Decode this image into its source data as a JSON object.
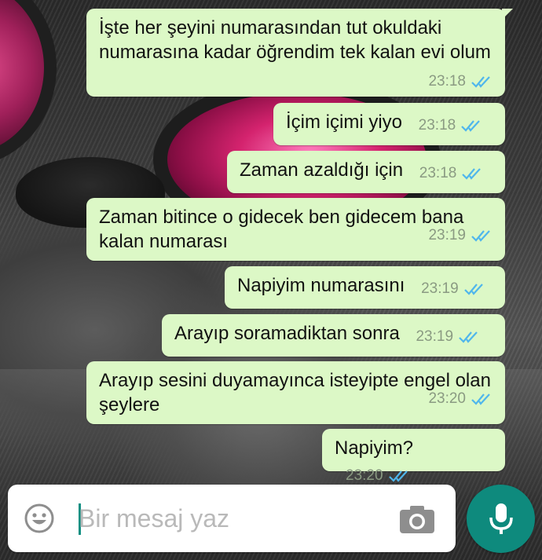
{
  "messages": [
    {
      "text": "İşte her şeyini numarasından tut okuldaki numarasına kadar öğrendim tek kalan evi olum",
      "time": "23:18",
      "status": "read"
    },
    {
      "text": "İçim içimi yiyo",
      "time": "23:18",
      "status": "read"
    },
    {
      "text": "Zaman azaldığı için",
      "time": "23:18",
      "status": "read"
    },
    {
      "text": "Zaman bitince o gidecek ben gidecem bana kalan numarası",
      "time": "23:19",
      "status": "read"
    },
    {
      "text": "Napiyim numarasını",
      "time": "23:19",
      "status": "read"
    },
    {
      "text": "Arayıp soramadiktan sonra",
      "time": "23:19",
      "status": "read"
    },
    {
      "text": "Arayıp sesini duyamayınca isteyipte engel olan şeylere",
      "time": "23:20",
      "status": "read"
    },
    {
      "text": "Napiyim?",
      "time": "23:20",
      "status": "read"
    }
  ],
  "input": {
    "placeholder": "Bir mesaj yaz",
    "emoji_icon": "emoji-icon",
    "camera_icon": "camera-icon",
    "mic_icon": "microphone-icon"
  },
  "colors": {
    "outgoing_bubble": "#dcf8c6",
    "read_ticks": "#4fb6ec",
    "accent": "#0e8a7d",
    "timestamp": "#8a9a82"
  }
}
